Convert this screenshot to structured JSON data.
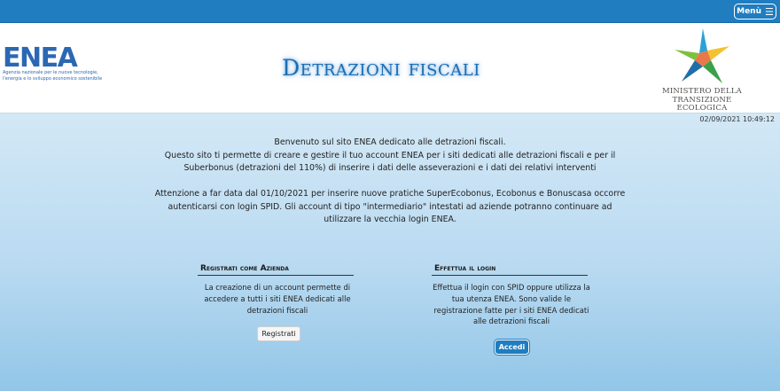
{
  "topbar": {
    "menu_label": "Menù",
    "menu_icon": "hamburger-icon"
  },
  "header": {
    "logo_text": "ENEA",
    "logo_tagline_lines": [
      "Agenzia nazionale per le nuove tecnologie,",
      "l'energia e lo sviluppo economico sostenibile"
    ],
    "title": "Detrazioni fiscali",
    "ministry_lines": [
      "MINISTERO DELLA",
      "TRANSIZIONE ECOLOGICA"
    ]
  },
  "timestamp": "02/09/2021 10:49:12",
  "intro_lines": [
    "Benvenuto sul sito ENEA dedicato alle detrazioni fiscali.",
    "Questo sito ti permette di creare e gestire il tuo account ENEA per i siti dedicati alle detrazioni fiscali e per il",
    "Suberbonus (detrazioni del 110%) di inserire i dati delle asseverazioni e i dati dei relativi interventi"
  ],
  "notice_lines": [
    "Attenzione a far data dal 01/10/2021 per inserire nuove pratiche SuperEcobonus, Ecobonus e Bonuscasa occorre",
    "autenticarsi con login SPID. Gli account di tipo \"intermediario\" intestati ad aziende potranno continuare ad",
    "utilizzare la vecchia login ENEA."
  ],
  "register_panel": {
    "title": "Registrati come Azienda",
    "text_lines": [
      "La creazione di un account permette di",
      "accedere a tutti i siti ENEA dedicati alle",
      "detrazioni fiscali"
    ],
    "button_label": "Registrati"
  },
  "login_panel": {
    "title": "Effettua il login",
    "text_lines": [
      "Effettua il login con SPID oppure utilizza la",
      "tua utenza ENEA. Sono valide le",
      "registrazione fatte per i siti ENEA dedicati",
      "alle detrazioni fiscali"
    ],
    "button_label": "Accedi"
  },
  "colors": {
    "brand_blue": "#1f7dc0",
    "title_blue": "#1a6fb5",
    "gradient_top": "#d3e8f6",
    "gradient_bottom": "#92c6e8"
  }
}
